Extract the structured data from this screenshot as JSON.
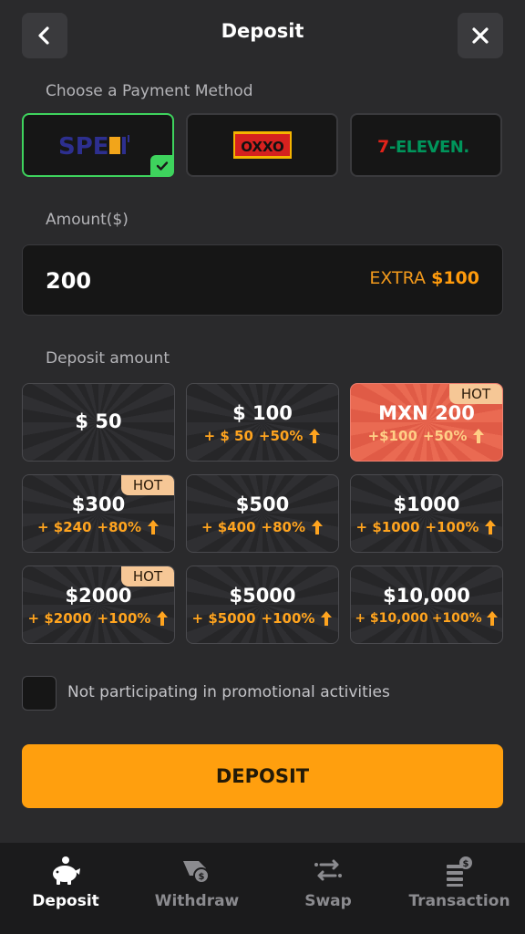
{
  "header": {
    "title": "Deposit"
  },
  "payment": {
    "label": "Choose a Payment Method",
    "methods": [
      {
        "name": "SPEI",
        "text": "SPE",
        "selected": true
      },
      {
        "name": "OXXO",
        "text": "OXXO",
        "selected": false
      },
      {
        "name": "7-ELEVEN",
        "text": "7-ELEVEN",
        "selected": false
      }
    ]
  },
  "amount": {
    "label": "Amount($)",
    "value": "200",
    "extra_prefix": "EXTRA",
    "extra_value": "$100"
  },
  "deposit_amount": {
    "label": "Deposit amount",
    "hot_label": "HOT",
    "options": [
      {
        "amount": "$ 50",
        "bonus": "",
        "percent": "",
        "hot": false,
        "active": false
      },
      {
        "amount": "$ 100",
        "bonus": "+ $ 50",
        "percent": "+50%",
        "hot": false,
        "active": false
      },
      {
        "amount": "MXN 200",
        "bonus": "+$100",
        "percent": "+50%",
        "hot": true,
        "active": true
      },
      {
        "amount": "$300",
        "bonus": "+ $240",
        "percent": "+80%",
        "hot": true,
        "active": false
      },
      {
        "amount": "$500",
        "bonus": "+ $400",
        "percent": "+80%",
        "hot": false,
        "active": false
      },
      {
        "amount": "$1000",
        "bonus": "+ $1000",
        "percent": "+100%",
        "hot": false,
        "active": false
      },
      {
        "amount": "$2000",
        "bonus": "+ $2000",
        "percent": "+100%",
        "hot": true,
        "active": false
      },
      {
        "amount": "$5000",
        "bonus": "+ $5000",
        "percent": "+100%",
        "hot": false,
        "active": false
      },
      {
        "amount": "$10,000",
        "bonus": "+ $10,000",
        "percent": "+100%",
        "hot": false,
        "active": false
      }
    ]
  },
  "promo": {
    "label": "Not participating in promotional activities",
    "checked": false
  },
  "deposit_button": {
    "label": "DEPOSIT"
  },
  "nav": {
    "items": [
      {
        "label": "Deposit",
        "icon": "piggy-bank-icon",
        "active": true
      },
      {
        "label": "Withdraw",
        "icon": "withdraw-icon",
        "active": false
      },
      {
        "label": "Swap",
        "icon": "swap-icon",
        "active": false
      },
      {
        "label": "Transaction",
        "icon": "transaction-icon",
        "active": false
      }
    ]
  },
  "colors": {
    "accent": "#ff9f0e",
    "selected": "#3ed35d",
    "hot": "#f6c796",
    "active_card": "#e05b46"
  }
}
